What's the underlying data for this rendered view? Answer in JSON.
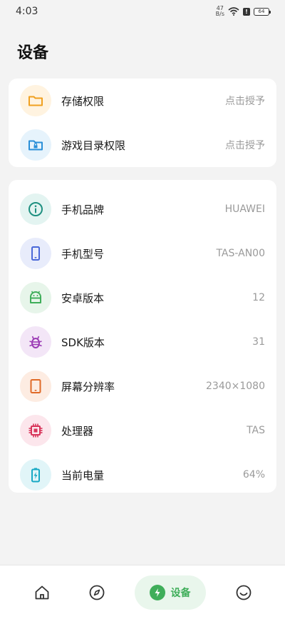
{
  "status": {
    "time": "4:03",
    "speed_top": "47",
    "speed_bottom": "B/s",
    "battery": "64"
  },
  "page": {
    "title": "设备"
  },
  "permissions": [
    {
      "label": "存储权限",
      "value": "点击授予",
      "icon": "folder-icon",
      "color": "#f0a020",
      "bg": "#fff3e0"
    },
    {
      "label": "游戏目录权限",
      "value": "点击授予",
      "icon": "folder-lock-icon",
      "color": "#2a8fd8",
      "bg": "#e6f3fc"
    }
  ],
  "device_info": [
    {
      "label": "手机品牌",
      "value": "HUAWEI",
      "icon": "info-icon",
      "color": "#1e9080",
      "bg": "#e3f4f1"
    },
    {
      "label": "手机型号",
      "value": "TAS-AN00",
      "icon": "phone-icon",
      "color": "#4a68d8",
      "bg": "#e8ecfb"
    },
    {
      "label": "安卓版本",
      "value": "12",
      "icon": "android-icon",
      "color": "#3fae5a",
      "bg": "#e7f5ea"
    },
    {
      "label": "SDK版本",
      "value": "31",
      "icon": "bug-icon",
      "color": "#9c3db5",
      "bg": "#f3e6f7"
    },
    {
      "label": "屏幕分辨率",
      "value": "2340×1080",
      "icon": "tablet-icon",
      "color": "#e06a28",
      "bg": "#fdece2"
    },
    {
      "label": "处理器",
      "value": "TAS",
      "icon": "chip-icon",
      "color": "#d8355a",
      "bg": "#fce6ec"
    },
    {
      "label": "当前电量",
      "value": "64%",
      "icon": "battery-charging-icon",
      "color": "#17a9c4",
      "bg": "#e1f5f8"
    }
  ],
  "nav": {
    "active_label": "设备"
  }
}
